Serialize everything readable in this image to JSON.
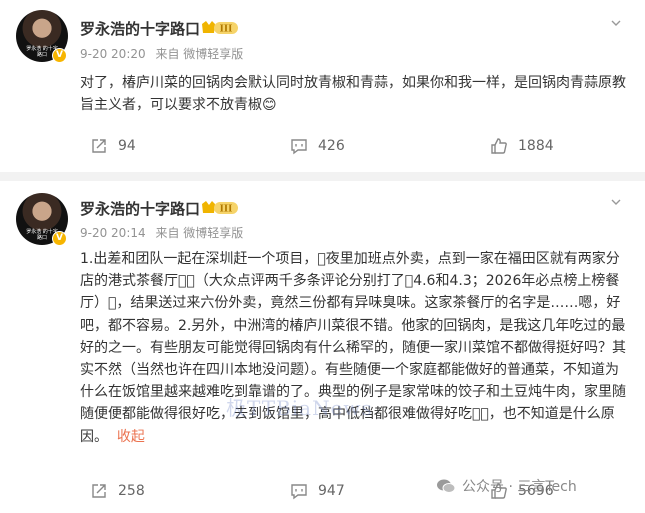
{
  "posts": [
    {
      "author": "罗永浩的十字路口",
      "level_badge": "III",
      "verified_mark": "V",
      "avatar_caption": "罗永浩 的十字路口",
      "time": "9-20 20:20",
      "source": "来自 微博轻享版",
      "text": "对了，椿庐川菜的回锅肉会默认同时放青椒和青蒜，如果你和我一样，是回锅肉青蒜原教旨主义者，可以要求不放青椒",
      "emoji": "😊",
      "reposts": "94",
      "comments": "426",
      "likes": "1884"
    },
    {
      "author": "罗永浩的十字路口",
      "level_badge": "III",
      "verified_mark": "V",
      "avatar_caption": "罗永浩 的十字路口",
      "time": "9-20 20:14",
      "source": "来自 微博轻享版",
      "text": "1.出差和团队一起在深圳赶一个项目，\u0000夜里加班点外卖，点到一家在福田区就有两家分店的港式茶餐厅\u0000\u0000（大众点评两千多条评论分别打了\u00004.6和4.3；2026年必点榜上榜餐厅）\u0000，结果送过来六份外卖，竟然三份都有异味臭味。这家茶餐厅的名字是……嗯，好吧，都不容易。2.另外，中洲湾的椿庐川菜很不错。他家的回锅肉，是我这几年吃过的最好的之一。有些朋友可能觉得回锅肉有什么稀罕的，随便一家川菜馆不都做得挺好吗？其实不然（当然也许在四川本地没问题）。有些随便一个家庭都能做好的普通菜，不知道为什么在饭馆里越来越难吃到靠谱的了。典型的例子是家常味的饺子和土豆炖牛肉，家里随随便便都能做得很好吃，去到饭馆里，高中低档都很难做得好吃\u0000\u0000，也不知道是什么原因。",
      "collapse_label": "收起",
      "reposts": "258",
      "comments": "947",
      "likes": "5696"
    }
  ],
  "watermark": "极TTBiaNews",
  "wechat_account": "公众号 · 三言Tech"
}
